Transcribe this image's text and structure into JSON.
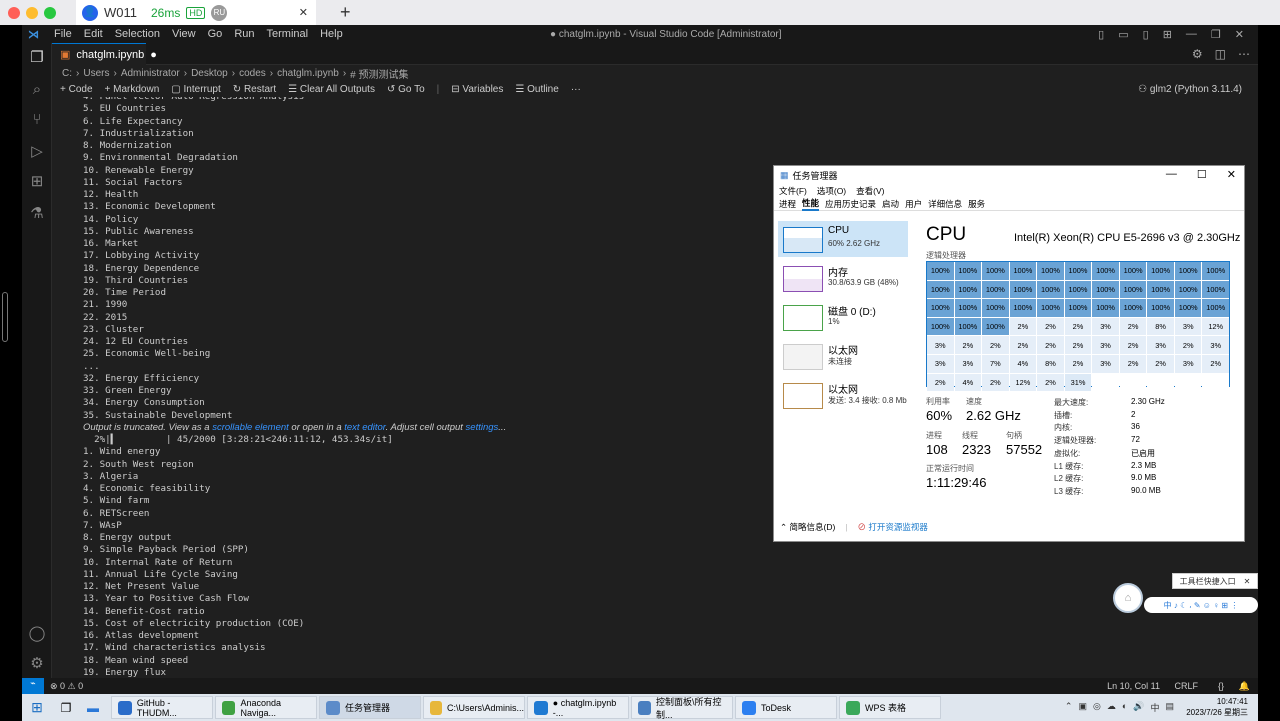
{
  "remote": {
    "tab_title": "W011",
    "latency": "26ms",
    "hd": "HD",
    "user": "RU"
  },
  "menubar": {
    "items": [
      "File",
      "Edit",
      "Selection",
      "View",
      "Go",
      "Run",
      "Terminal",
      "Help"
    ],
    "title": "● chatglm.ipynb - Visual Studio Code [Administrator]"
  },
  "tab": {
    "name": "chatglm.ipynb",
    "modified": "●"
  },
  "breadcrumbs": [
    "C:",
    "Users",
    "Administrator",
    "Desktop",
    "codes",
    "chatglm.ipynb",
    "# 预测测试集"
  ],
  "toolbar": {
    "code": "+ Code",
    "markdown": "+ Markdown",
    "interrupt": "Interrupt",
    "restart": "Restart",
    "clear": "Clear All Outputs",
    "goto": "Go To",
    "variables": "Variables",
    "outline": "Outline",
    "more": "···",
    "kernel": "glm2 (Python 3.11.4)"
  },
  "output_lines_a": [
    "4. Panel Vector Auto Regression Analysis",
    "5. EU Countries",
    "6. Life Expectancy",
    "7. Industrialization",
    "8. Modernization",
    "9. Environmental Degradation",
    "10. Renewable Energy",
    "11. Social Factors",
    "12. Health",
    "13. Economic Development",
    "14. Policy",
    "15. Public Awareness",
    "16. Market",
    "17. Lobbying Activity",
    "18. Energy Dependence",
    "19. Third Countries",
    "20. Time Period",
    "21. 1990",
    "22. 2015",
    "23. Cluster",
    "24. 12 EU Countries",
    "25. Economic Well-being",
    "...",
    "32. Energy Efficiency",
    "33. Green Energy",
    "34. Energy Consumption",
    "35. Sustainable Development"
  ],
  "truncated_note": {
    "prefix": "Output is truncated. View as a ",
    "link1": "scrollable element",
    "middle": " or open in a ",
    "link2": "text editor",
    "suffix": ". Adjust cell output ",
    "link3": "settings",
    "end": "..."
  },
  "progress_line": "  2%|▍         | 45/2000 [3:28:21<246:11:12, 453.34s/it]",
  "output_lines_b": [
    "1. Wind energy",
    "2. South West region",
    "3. Algeria",
    "4. Economic feasibility",
    "5. Wind farm",
    "6. RETScreen",
    "7. WAsP",
    "8. Energy output",
    "9. Simple Payback Period (SPP)",
    "10. Internal Rate of Return",
    "11. Annual Life Cycle Saving",
    "12. Net Present Value",
    "13. Year to Positive Cash Flow",
    "14. Benefit-Cost ratio",
    "15. Cost of electricity production (COE)",
    "16. Atlas development",
    "17. Wind characteristics analysis",
    "18. Mean wind speed",
    "19. Energy flux"
  ],
  "status": {
    "remote": "⌁",
    "problems": "⊗ 0 ⚠ 0",
    "position": "Ln 10, Col 11",
    "eol": "CRLF"
  },
  "taskmgr": {
    "title": "任务管理器",
    "menu": [
      "文件(F)",
      "选项(O)",
      "查看(V)"
    ],
    "tabs": [
      "进程",
      "性能",
      "应用历史记录",
      "启动",
      "用户",
      "详细信息",
      "服务"
    ],
    "side": [
      {
        "name": "CPU",
        "sub": "60% 2.62 GHz"
      },
      {
        "name": "内存",
        "sub": "30.8/63.9 GB (48%)"
      },
      {
        "name": "磁盘 0 (D:)",
        "sub": "1%"
      },
      {
        "name": "以太网",
        "sub": "未连接"
      },
      {
        "name": "以太网",
        "sub": "发送: 3.4 接收: 0.8 Mb"
      }
    ],
    "cpu_title": "CPU",
    "cpu_name": "Intel(R) Xeon(R) CPU E5-2696 v3 @ 2.30GHz",
    "grid_label": "逻辑处理器",
    "cores": [
      "100%",
      "100%",
      "100%",
      "100%",
      "100%",
      "100%",
      "100%",
      "100%",
      "100%",
      "100%",
      "100%",
      "100%",
      "100%",
      "100%",
      "100%",
      "100%",
      "100%",
      "100%",
      "100%",
      "100%",
      "100%",
      "100%",
      "100%",
      "100%",
      "100%",
      "100%",
      "100%",
      "100%",
      "100%",
      "100%",
      "100%",
      "100%",
      "100%",
      "100%",
      "100%",
      "100%",
      "2%",
      "2%",
      "2%",
      "3%",
      "2%",
      "8%",
      "3%",
      "12%",
      "3%",
      "2%",
      "2%",
      "2%",
      "2%",
      "2%",
      "3%",
      "2%",
      "3%",
      "2%",
      "3%",
      "3%",
      "3%",
      "7%",
      "4%",
      "8%",
      "2%",
      "3%",
      "2%",
      "2%",
      "3%",
      "2%",
      "2%",
      "4%",
      "2%",
      "12%",
      "2%",
      "31%"
    ],
    "util_label": "利用率",
    "util": "60%",
    "speed_label": "速度",
    "speed": "2.62 GHz",
    "proc_label": "进程",
    "proc": "108",
    "thread_label": "线程",
    "thread": "2323",
    "handle_label": "句柄",
    "handle": "57552",
    "uptime_label": "正常运行时间",
    "uptime": "1:11:29:46",
    "specs": [
      [
        "最大速度:",
        "2.30 GHz"
      ],
      [
        "插槽:",
        "2"
      ],
      [
        "内核:",
        "36"
      ],
      [
        "逻辑处理器:",
        "72"
      ],
      [
        "虚拟化:",
        "已启用"
      ],
      [
        "L1 缓存:",
        "2.3 MB"
      ],
      [
        "L2 缓存:",
        "9.0 MB"
      ],
      [
        "L3 缓存:",
        "90.0 MB"
      ]
    ],
    "footer_less": "简略信息(D)",
    "footer_link": "打开资源监视器"
  },
  "widget": {
    "popup": "工具栏快捷入口",
    "bar": "中 ♪ ☾ ⸴ ✎ ☺ ♀ ⊞ ⋮"
  },
  "taskbar": {
    "items": [
      {
        "label": "GitHub - THUDM...",
        "color": "#2a6cc9"
      },
      {
        "label": "Anaconda Naviga...",
        "color": "#3fa142"
      },
      {
        "label": "任务管理器",
        "color": "#5c8bc9"
      },
      {
        "label": "C:\\Users\\Adminis...",
        "color": "#e7b73b"
      },
      {
        "label": "● chatglm.ipynb -...",
        "color": "#1f7ad2"
      },
      {
        "label": "控制面板\\所有控制...",
        "color": "#4a7fc0"
      },
      {
        "label": "ToDesk",
        "color": "#2c7ff0"
      },
      {
        "label": "WPS 表格",
        "color": "#3aa85a"
      }
    ],
    "time": "10:47:41",
    "date": "2023/7/26 星期三"
  }
}
